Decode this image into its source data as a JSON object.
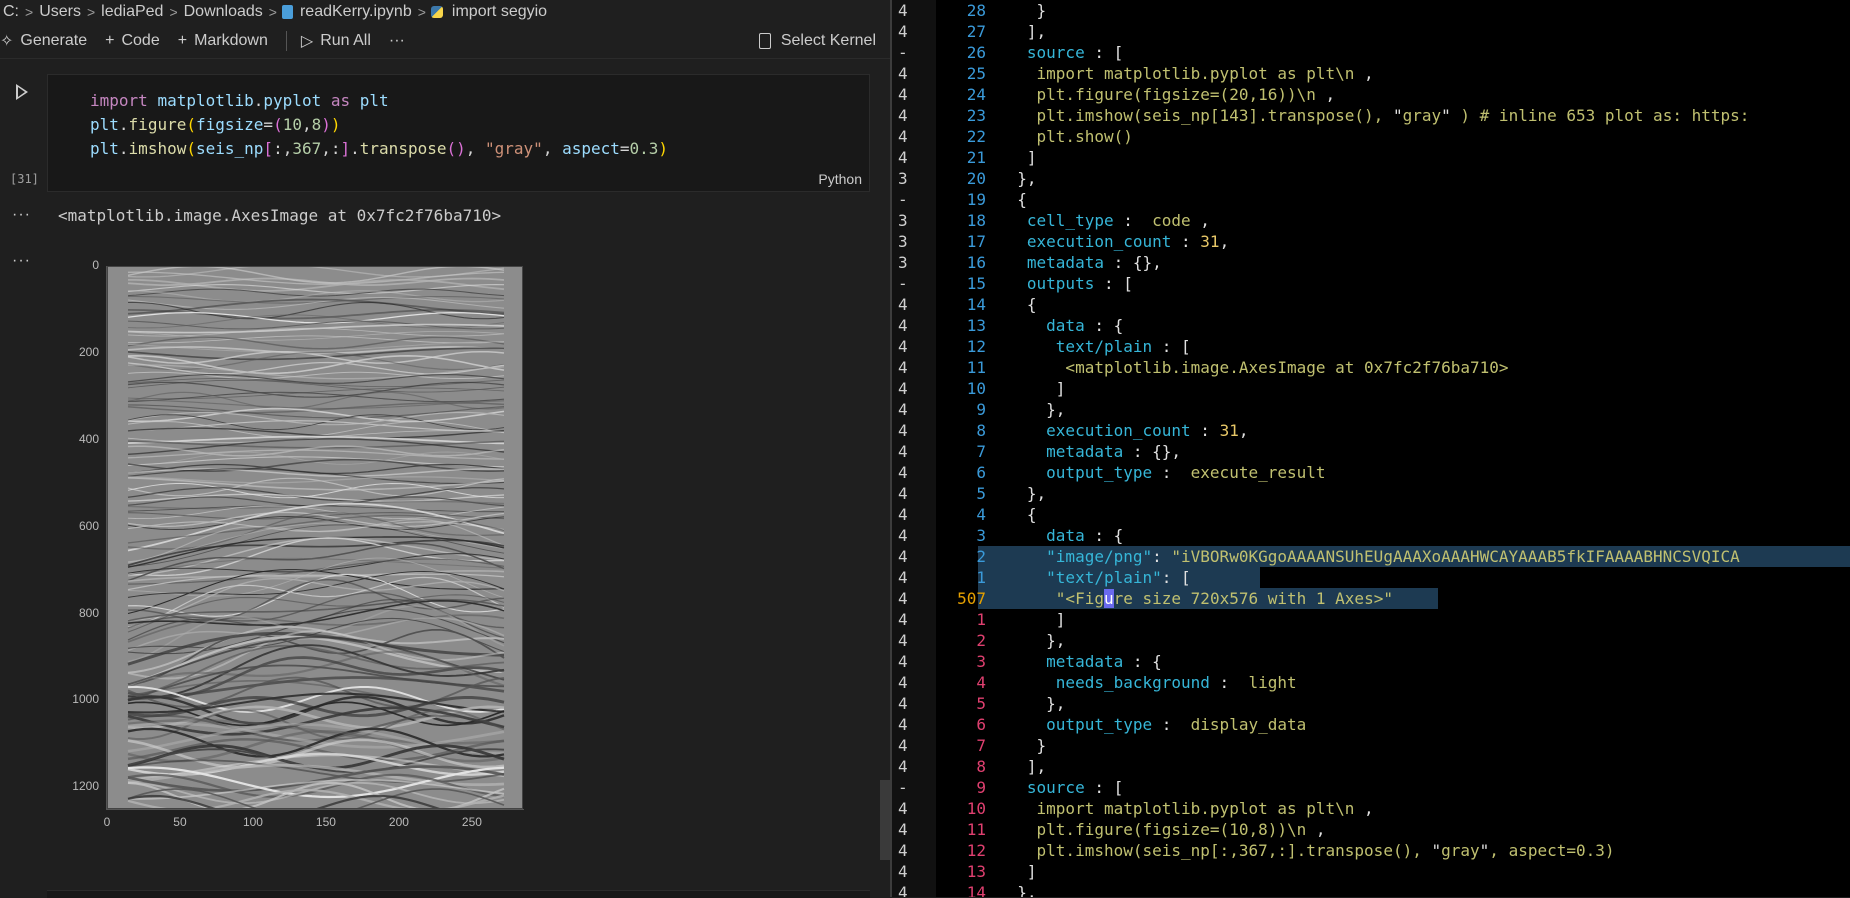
{
  "breadcrumb": [
    "C:",
    "Users",
    "lediaPed",
    "Downloads",
    "readKerry.ipynb",
    "import segyio"
  ],
  "toolbar": {
    "generate": "Generate",
    "code": "Code",
    "markdown": "Markdown",
    "run_all": "Run All",
    "more": "···",
    "select_kernel": "Select Kernel"
  },
  "cell": {
    "execution_count": "[31]",
    "language": "Python",
    "output_text": "<matplotlib.image.AxesImage at 0x7fc2f76ba710>",
    "output_dots": "···",
    "code_lines": [
      [
        [
          "kw",
          "import "
        ],
        [
          "var",
          "matplotlib"
        ],
        [
          "plain",
          "."
        ],
        [
          "var",
          "pyplot"
        ],
        [
          "kw",
          " as "
        ],
        [
          "var",
          "plt"
        ]
      ],
      [
        [
          "var",
          "plt"
        ],
        [
          "plain",
          "."
        ],
        [
          "fn",
          "figure"
        ],
        [
          "b1",
          "("
        ],
        [
          "var",
          "figsize"
        ],
        [
          "plain",
          "="
        ],
        [
          "b2",
          "("
        ],
        [
          "num",
          "10"
        ],
        [
          "plain",
          ","
        ],
        [
          "num",
          "8"
        ],
        [
          "b2",
          ")"
        ],
        [
          "b1",
          ")"
        ]
      ],
      [
        [
          "var",
          "plt"
        ],
        [
          "plain",
          "."
        ],
        [
          "fn",
          "imshow"
        ],
        [
          "b1",
          "("
        ],
        [
          "var",
          "seis_np"
        ],
        [
          "b2",
          "["
        ],
        [
          "plain",
          ":,"
        ],
        [
          "num",
          "367"
        ],
        [
          "plain",
          ",:"
        ],
        [
          "b2",
          "]"
        ],
        [
          "plain",
          "."
        ],
        [
          "fn",
          "transpose"
        ],
        [
          "b2",
          "()"
        ],
        [
          "plain",
          ", "
        ],
        [
          "str",
          "\"gray\""
        ],
        [
          "plain",
          ", "
        ],
        [
          "var",
          "aspect"
        ],
        [
          "plain",
          "="
        ],
        [
          "num",
          "0.3"
        ],
        [
          "b1",
          ")"
        ]
      ]
    ]
  },
  "plot": {
    "y_ticks": [
      "0",
      "200",
      "400",
      "600",
      "800",
      "1000",
      "1200"
    ],
    "x_ticks": [
      "0",
      "50",
      "100",
      "150",
      "200",
      "250"
    ]
  },
  "editor_lines": [
    {
      "fold": "4",
      "ln": "28",
      "cls": "",
      "parts": [
        [
          "p",
          "    }"
        ]
      ]
    },
    {
      "fold": "4",
      "ln": "27",
      "cls": "",
      "parts": [
        [
          "p",
          "   ],"
        ]
      ]
    },
    {
      "fold": "-",
      "ln": "26",
      "cls": "",
      "parts": [
        [
          "k",
          "   source"
        ],
        [
          "p",
          " : ["
        ]
      ]
    },
    {
      "fold": "4",
      "ln": "25",
      "cls": "",
      "parts": [
        [
          "s",
          "    import matplotlib.pyplot as plt\\n"
        ],
        [
          "p",
          " ,"
        ]
      ]
    },
    {
      "fold": "4",
      "ln": "24",
      "cls": "",
      "parts": [
        [
          "s",
          "    plt.figure(figsize=(20,16))\\n"
        ],
        [
          "p",
          " ,"
        ]
      ]
    },
    {
      "fold": "4",
      "ln": "23",
      "cls": "",
      "parts": [
        [
          "s",
          "    plt.imshow(seis_np[143].transpose(), "
        ],
        [
          "p",
          "\""
        ],
        [
          "s",
          "gray"
        ],
        [
          "p",
          "\""
        ],
        [
          "s",
          " ) # inline 653 plot as: https:"
        ]
      ]
    },
    {
      "fold": "4",
      "ln": "22",
      "cls": "",
      "parts": [
        [
          "s",
          "    plt.show()"
        ]
      ]
    },
    {
      "fold": "4",
      "ln": "21",
      "cls": "",
      "parts": [
        [
          "p",
          "   ]"
        ]
      ]
    },
    {
      "fold": "3",
      "ln": "20",
      "cls": "",
      "parts": [
        [
          "p",
          "  },"
        ]
      ]
    },
    {
      "fold": "-",
      "ln": "19",
      "cls": "",
      "parts": [
        [
          "p",
          "  {"
        ]
      ]
    },
    {
      "fold": "3",
      "ln": "18",
      "cls": "",
      "parts": [
        [
          "k",
          "   cell_type"
        ],
        [
          "p",
          " :  "
        ],
        [
          "s",
          "code"
        ],
        [
          "p",
          " ,"
        ]
      ]
    },
    {
      "fold": "3",
      "ln": "17",
      "cls": "",
      "parts": [
        [
          "k",
          "   execution_count"
        ],
        [
          "p",
          " : "
        ],
        [
          "n",
          "31"
        ],
        [
          "p",
          ","
        ]
      ]
    },
    {
      "fold": "3",
      "ln": "16",
      "cls": "",
      "parts": [
        [
          "k",
          "   metadata"
        ],
        [
          "p",
          " : {},"
        ]
      ]
    },
    {
      "fold": "-",
      "ln": "15",
      "cls": "",
      "parts": [
        [
          "k",
          "   outputs"
        ],
        [
          "p",
          " : ["
        ]
      ]
    },
    {
      "fold": "4",
      "ln": "14",
      "cls": "",
      "parts": [
        [
          "p",
          "   {"
        ]
      ]
    },
    {
      "fold": "4",
      "ln": "13",
      "cls": "",
      "parts": [
        [
          "k",
          "     data"
        ],
        [
          "p",
          " : {"
        ]
      ]
    },
    {
      "fold": "4",
      "ln": "12",
      "cls": "",
      "parts": [
        [
          "k",
          "      text/plain"
        ],
        [
          "p",
          " : ["
        ]
      ]
    },
    {
      "fold": "4",
      "ln": "11",
      "cls": "",
      "parts": [
        [
          "s",
          "       <matplotlib.image.AxesImage at 0x7fc2f76ba710>"
        ]
      ]
    },
    {
      "fold": "4",
      "ln": "10",
      "cls": "",
      "parts": [
        [
          "p",
          "      ]"
        ]
      ]
    },
    {
      "fold": "4",
      "ln": "9",
      "cls": "",
      "parts": [
        [
          "p",
          "     },"
        ]
      ]
    },
    {
      "fold": "4",
      "ln": "8",
      "cls": "",
      "parts": [
        [
          "k",
          "     execution_count"
        ],
        [
          "p",
          " : "
        ],
        [
          "n",
          "31"
        ],
        [
          "p",
          ","
        ]
      ]
    },
    {
      "fold": "4",
      "ln": "7",
      "cls": "",
      "parts": [
        [
          "k",
          "     metadata"
        ],
        [
          "p",
          " : {},"
        ]
      ]
    },
    {
      "fold": "4",
      "ln": "6",
      "cls": "",
      "parts": [
        [
          "k",
          "     output_type"
        ],
        [
          "p",
          " :  "
        ],
        [
          "s",
          "execute_result"
        ]
      ]
    },
    {
      "fold": "4",
      "ln": "5",
      "cls": "",
      "parts": [
        [
          "p",
          "   },"
        ]
      ]
    },
    {
      "fold": "4",
      "ln": "4",
      "cls": "",
      "parts": [
        [
          "p",
          "   {"
        ]
      ]
    },
    {
      "fold": "4",
      "ln": "3",
      "cls": "",
      "parts": [
        [
          "k",
          "     data"
        ],
        [
          "p",
          " : {"
        ]
      ]
    },
    {
      "fold": "4",
      "ln": "2",
      "cls": "",
      "parts": [
        [
          "k",
          "     \"image/png\""
        ],
        [
          "p",
          ": "
        ],
        [
          "s",
          "\"iVBORw0KGgoAAAANSUhEUgAAAXoAAAHWCAYAAAB5fkIFAAAABHNCSVQICA"
        ]
      ]
    },
    {
      "fold": "4",
      "ln": "1",
      "cls": "",
      "parts": [
        [
          "k",
          "     \"text/plain\""
        ],
        [
          "p",
          ": ["
        ]
      ]
    },
    {
      "fold": "4",
      "ln": "507",
      "cls": "cur",
      "parts": [
        [
          "s",
          "      \"<Fig"
        ],
        [
          "cursor",
          "u"
        ],
        [
          "s",
          "re size 720x576 with 1 Axes>\""
        ]
      ]
    },
    {
      "fold": "4",
      "ln": "1",
      "cls": "red",
      "parts": [
        [
          "p",
          "      ]"
        ]
      ]
    },
    {
      "fold": "4",
      "ln": "2",
      "cls": "red",
      "parts": [
        [
          "p",
          "     },"
        ]
      ]
    },
    {
      "fold": "4",
      "ln": "3",
      "cls": "red",
      "parts": [
        [
          "k",
          "     metadata"
        ],
        [
          "p",
          " : {"
        ]
      ]
    },
    {
      "fold": "4",
      "ln": "4",
      "cls": "red",
      "parts": [
        [
          "k",
          "      needs_background"
        ],
        [
          "p",
          " :  "
        ],
        [
          "s",
          "light"
        ]
      ]
    },
    {
      "fold": "4",
      "ln": "5",
      "cls": "red",
      "parts": [
        [
          "p",
          "     },"
        ]
      ]
    },
    {
      "fold": "4",
      "ln": "6",
      "cls": "red",
      "parts": [
        [
          "k",
          "     output_type"
        ],
        [
          "p",
          " :  "
        ],
        [
          "s",
          "display_data"
        ]
      ]
    },
    {
      "fold": "4",
      "ln": "7",
      "cls": "red",
      "parts": [
        [
          "p",
          "    }"
        ]
      ]
    },
    {
      "fold": "4",
      "ln": "8",
      "cls": "red",
      "parts": [
        [
          "p",
          "   ],"
        ]
      ]
    },
    {
      "fold": "-",
      "ln": "9",
      "cls": "red",
      "parts": [
        [
          "k",
          "   source"
        ],
        [
          "p",
          " : ["
        ]
      ]
    },
    {
      "fold": "4",
      "ln": "10",
      "cls": "red",
      "parts": [
        [
          "s",
          "    import matplotlib.pyplot as plt\\n"
        ],
        [
          "p",
          " ,"
        ]
      ]
    },
    {
      "fold": "4",
      "ln": "11",
      "cls": "red",
      "parts": [
        [
          "s",
          "    plt.figure(figsize=(10,8))\\n"
        ],
        [
          "p",
          " ,"
        ]
      ]
    },
    {
      "fold": "4",
      "ln": "12",
      "cls": "red",
      "parts": [
        [
          "s",
          "    plt.imshow(seis_np[:,367,:].transpose(), "
        ],
        [
          "p",
          "\""
        ],
        [
          "s",
          "gray"
        ],
        [
          "p",
          "\""
        ],
        [
          "s",
          ", aspect=0.3)"
        ]
      ]
    },
    {
      "fold": "4",
      "ln": "13",
      "cls": "red",
      "parts": [
        [
          "p",
          "   ]"
        ]
      ]
    },
    {
      "fold": "4",
      "ln": "14",
      "cls": "red",
      "parts": [
        [
          "p",
          "  },"
        ]
      ]
    }
  ]
}
